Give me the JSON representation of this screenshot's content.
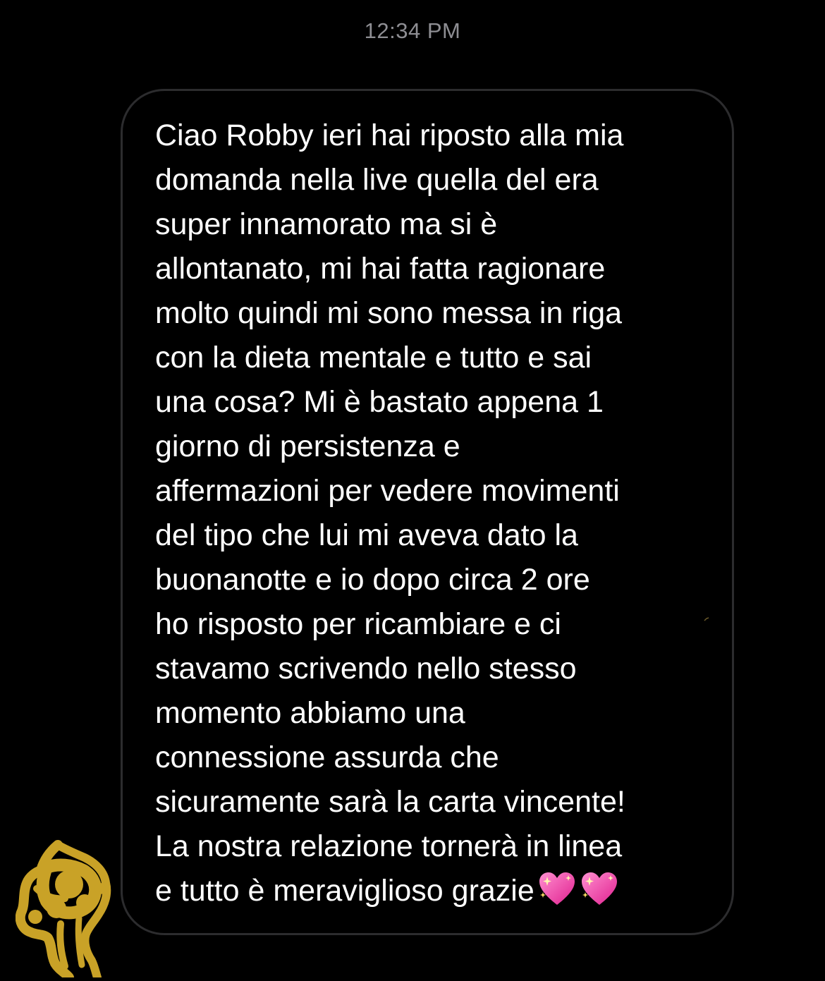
{
  "timestamp": "12:34 PM",
  "message": {
    "lines": [
      "Ciao Robby ieri hai riposto alla mia",
      "domanda nella live quella del era",
      "super innamorato ma si è",
      "allontanato, mi hai fatta ragionare",
      "molto quindi mi sono messa in riga",
      "con la dieta mentale e tutto e sai",
      "una cosa? Mi è bastato appena 1",
      "giorno di persistenza e",
      "affermazioni per vedere movimenti",
      "del tipo che lui mi aveva dato la",
      "buonanotte e io dopo circa 2 ore",
      "ho risposto per ricambiare e ci",
      "stavamo scrivendo nello stesso",
      "momento abbiamo una",
      "connessione assurda che",
      "sicuramente sarà la carta vincente!",
      "La nostra relazione tornerà in linea",
      "e tutto è meraviglioso grazie"
    ],
    "emoji": [
      "sparkling-heart",
      "sparkling-heart"
    ]
  },
  "colors": {
    "background": "#000000",
    "bubble_border": "#2c2c2e",
    "text": "#ffffff",
    "timestamp": "#8e8e93",
    "heart": "#ff4fb3",
    "doodle": "#c9a227"
  }
}
